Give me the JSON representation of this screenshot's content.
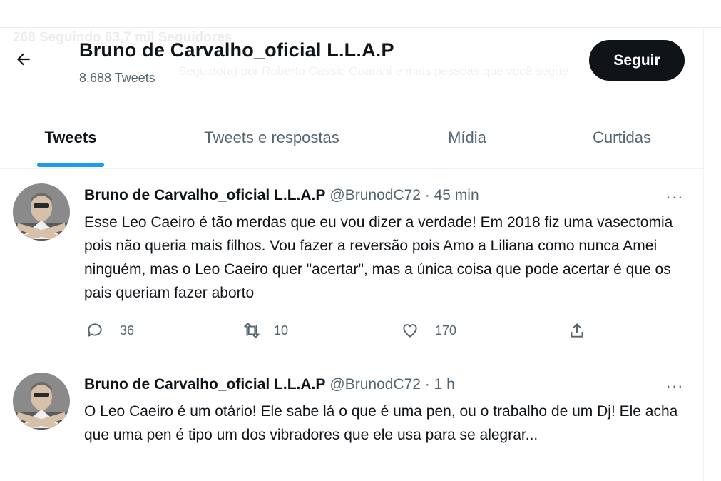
{
  "header": {
    "ghost_stats": "268 Seguindo    63,7 mil Seguidores",
    "ghost_bio": "Seguido(a) por Roberto Cassio Guarani e mais pessoas que você segue",
    "title": "Bruno de Carvalho_oficial L.L.A.P",
    "tweet_count": "8.688 Tweets",
    "follow_label": "Seguir"
  },
  "tabs": [
    {
      "label": "Tweets",
      "active": true
    },
    {
      "label": "Tweets e respostas",
      "active": false
    },
    {
      "label": "Mídia",
      "active": false
    },
    {
      "label": "Curtidas",
      "active": false
    }
  ],
  "colors": {
    "accent": "#1d9bf0",
    "text": "#0f1419",
    "muted": "#536471"
  },
  "tweets": [
    {
      "name": "Bruno de Carvalho_oficial L.L.A.P",
      "meta": "@BrunodC72 · 45 min",
      "text": "Esse Leo Caeiro é tão merdas que eu vou dizer a verdade! Em 2018 fiz uma vasectomia pois não queria mais filhos. Vou fazer a reversão pois Amo a Liliana como nunca Amei ninguém, mas o Leo Caeiro quer \"acertar\", mas a única coisa que pode acertar é que os pais queriam fazer aborto",
      "more": "···",
      "replies": "36",
      "retweets": "10",
      "likes": "170"
    },
    {
      "name": "Bruno de Carvalho_oficial L.L.A.P",
      "meta": "@BrunodC72 · 1 h",
      "text": "O Leo Caeiro é um otário! Ele sabe lá o que é uma pen, ou o trabalho de um Dj! Ele acha que uma pen é tipo um dos vibradores que ele usa para se alegrar...",
      "more": "···"
    }
  ]
}
